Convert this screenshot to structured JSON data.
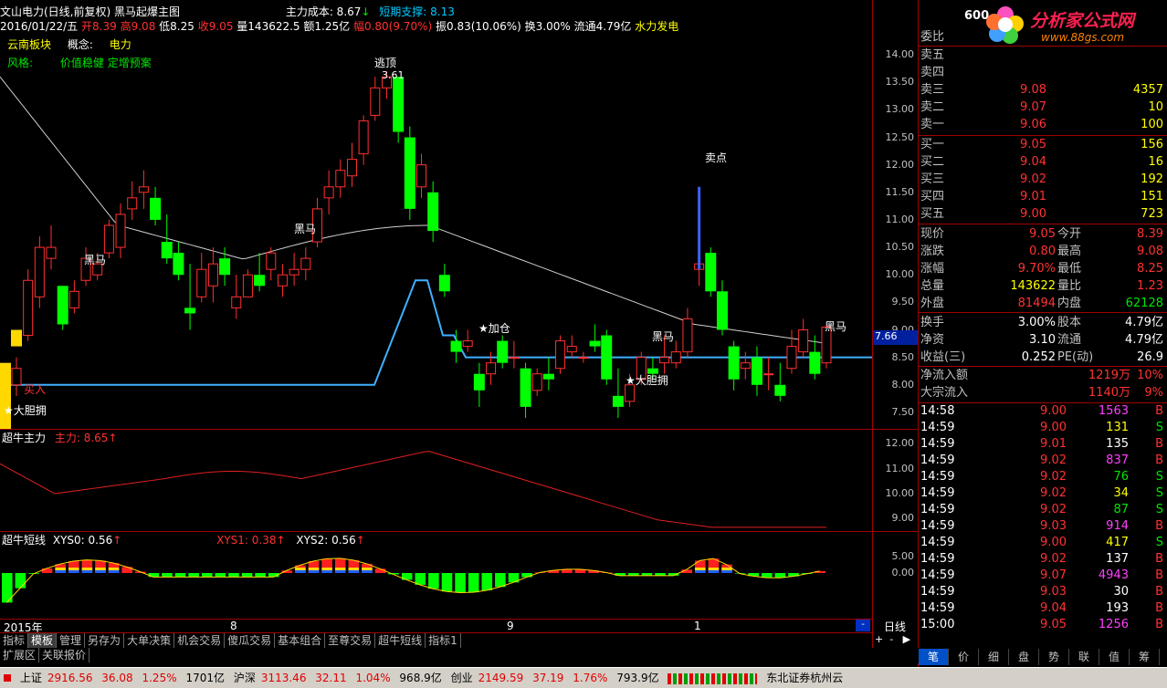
{
  "header": {
    "title": "文山电力(日线,前复权) 黑马起爆主图",
    "cost_label": "主力成本: 8.67",
    "cost_arrow": "↓",
    "support_label": "短期支撑: 8.13",
    "date": "2016/01/22/五",
    "open": "开8.39",
    "high": "高9.08",
    "low": "低8.25",
    "close": "收9.05",
    "vol": "量143622.5",
    "amount": "额1.25亿",
    "change": "幅0.80(9.70%)",
    "amplitude": "振0.83(10.06%)",
    "turnover": "换3.00%",
    "float": "流通4.79亿",
    "industry": "水力发电"
  },
  "tags": {
    "sector": "云南板块",
    "concept_label": "概念:",
    "concept": "电力",
    "style_label": "风格:",
    "style": "价值稳健 定增预案"
  },
  "annotations": {
    "escape": "逃顶",
    "escape_price": "3.61",
    "sell": "卖点",
    "heima": "黑马",
    "bold": "★大胆拥",
    "add": "★加仓",
    "buy": "买入"
  },
  "price_axis": [
    "14.00",
    "13.50",
    "13.00",
    "12.50",
    "12.00",
    "11.50",
    "11.00",
    "10.50",
    "10.00",
    "9.50",
    "9.00",
    "8.50",
    "8.00",
    "7.50"
  ],
  "cursor_price": "7.66",
  "indicator1": {
    "name": "超牛主力",
    "value": "主力: 8.65",
    "arrow": "↑",
    "axis": [
      "12.00",
      "11.00",
      "10.00",
      "9.00"
    ]
  },
  "indicator2": {
    "name": "超牛短线",
    "xys0": "XYS0: 0.56",
    "xys1": "XYS1: 0.38",
    "xys2": "XYS2: 0.56",
    "axis": [
      "5.00",
      "0.00"
    ]
  },
  "time_axis": {
    "year": "2015年",
    "m8": "8",
    "m9": "9",
    "m1": "1",
    "period": "日线"
  },
  "chart_data": {
    "type": "candlestick",
    "ylim": [
      7.2,
      14.4
    ],
    "candles": [
      [
        8.0,
        8.5,
        7.8,
        8.3
      ],
      [
        8.9,
        10.1,
        8.8,
        9.9
      ],
      [
        9.6,
        10.7,
        9.4,
        10.5
      ],
      [
        10.3,
        10.9,
        10.1,
        10.5
      ],
      [
        9.8,
        9.8,
        9.0,
        9.1
      ],
      [
        9.4,
        9.9,
        9.3,
        9.7
      ],
      [
        9.9,
        10.5,
        9.8,
        10.3
      ],
      [
        10.0,
        10.4,
        9.9,
        10.2
      ],
      [
        10.4,
        11.0,
        10.3,
        10.9
      ],
      [
        10.5,
        11.3,
        10.3,
        11.1
      ],
      [
        11.2,
        11.7,
        11.0,
        11.4
      ],
      [
        11.5,
        11.9,
        11.2,
        11.6
      ],
      [
        11.4,
        11.6,
        10.9,
        11.0
      ],
      [
        10.6,
        11.1,
        10.2,
        10.3
      ],
      [
        10.4,
        10.6,
        9.9,
        10.0
      ],
      [
        9.4,
        10.2,
        9.0,
        9.3
      ],
      [
        9.6,
        10.4,
        9.5,
        10.1
      ],
      [
        9.8,
        10.5,
        9.5,
        10.2
      ],
      [
        10.3,
        10.5,
        9.8,
        10.0
      ],
      [
        9.4,
        10.0,
        9.2,
        9.6
      ],
      [
        9.6,
        10.1,
        9.6,
        10.0
      ],
      [
        10.0,
        10.4,
        9.7,
        9.8
      ],
      [
        10.1,
        10.5,
        9.9,
        10.4
      ],
      [
        9.8,
        10.2,
        9.6,
        10.0
      ],
      [
        10.0,
        10.4,
        9.8,
        10.1
      ],
      [
        10.1,
        10.5,
        9.9,
        10.3
      ],
      [
        10.6,
        11.4,
        10.5,
        11.2
      ],
      [
        11.4,
        11.9,
        11.1,
        11.6
      ],
      [
        11.6,
        12.1,
        11.4,
        11.9
      ],
      [
        11.8,
        12.4,
        11.6,
        12.1
      ],
      [
        12.2,
        12.9,
        12.0,
        12.8
      ],
      [
        12.9,
        13.6,
        12.8,
        13.4
      ],
      [
        13.4,
        13.7,
        13.2,
        13.6
      ],
      [
        13.6,
        13.6,
        12.4,
        12.6
      ],
      [
        12.5,
        12.7,
        11.0,
        11.2
      ],
      [
        11.6,
        12.2,
        11.4,
        12.0
      ],
      [
        11.5,
        11.7,
        10.6,
        10.8
      ],
      [
        10.0,
        10.2,
        9.6,
        9.7
      ],
      [
        8.8,
        9.0,
        8.4,
        8.6
      ],
      [
        8.7,
        9.0,
        8.6,
        8.8
      ],
      [
        8.2,
        8.4,
        7.6,
        7.9
      ],
      [
        8.2,
        8.6,
        8.0,
        8.4
      ],
      [
        8.8,
        8.9,
        8.3,
        8.4
      ],
      [
        8.5,
        8.8,
        8.3,
        8.5
      ],
      [
        8.3,
        8.4,
        7.4,
        7.6
      ],
      [
        7.9,
        8.3,
        7.8,
        8.2
      ],
      [
        8.2,
        8.5,
        7.9,
        8.1
      ],
      [
        8.3,
        8.9,
        8.2,
        8.8
      ],
      [
        8.6,
        8.9,
        8.5,
        8.7
      ],
      [
        8.5,
        8.6,
        8.4,
        8.5
      ],
      [
        8.8,
        9.1,
        8.6,
        8.7
      ],
      [
        8.9,
        9.0,
        8.0,
        8.1
      ],
      [
        7.8,
        8.3,
        7.4,
        7.6
      ],
      [
        7.7,
        8.2,
        7.6,
        8.0
      ],
      [
        8.1,
        8.6,
        8.0,
        8.5
      ],
      [
        8.3,
        8.5,
        8.1,
        8.2
      ],
      [
        8.4,
        8.9,
        8.2,
        8.5
      ],
      [
        8.4,
        8.8,
        8.3,
        8.6
      ],
      [
        8.6,
        9.4,
        8.5,
        9.2
      ],
      [
        10.1,
        11.2,
        9.8,
        10.2
      ],
      [
        10.4,
        10.5,
        9.6,
        9.7
      ],
      [
        9.7,
        9.9,
        8.9,
        9.0
      ],
      [
        8.7,
        8.8,
        7.9,
        8.1
      ],
      [
        8.3,
        8.6,
        8.1,
        8.4
      ],
      [
        8.5,
        8.7,
        7.8,
        8.0
      ],
      [
        8.2,
        8.5,
        7.9,
        8.2
      ],
      [
        8.0,
        8.4,
        7.7,
        7.8
      ],
      [
        8.3,
        9.0,
        8.2,
        8.7
      ],
      [
        8.6,
        9.2,
        8.5,
        9.0
      ],
      [
        8.6,
        8.9,
        8.1,
        8.2
      ],
      [
        8.4,
        9.1,
        8.3,
        9.05
      ]
    ]
  },
  "quote": {
    "code": "600",
    "wb_label": "委比",
    "sell": [
      {
        "l": "卖五",
        "p": "",
        "v": ""
      },
      {
        "l": "卖四",
        "p": "",
        "v": ""
      },
      {
        "l": "卖三",
        "p": "9.08",
        "v": "4357"
      },
      {
        "l": "卖二",
        "p": "9.07",
        "v": "10"
      },
      {
        "l": "卖一",
        "p": "9.06",
        "v": "100"
      }
    ],
    "buy": [
      {
        "l": "买一",
        "p": "9.05",
        "v": "156"
      },
      {
        "l": "买二",
        "p": "9.04",
        "v": "16"
      },
      {
        "l": "买三",
        "p": "9.02",
        "v": "192"
      },
      {
        "l": "买四",
        "p": "9.01",
        "v": "151"
      },
      {
        "l": "买五",
        "p": "9.00",
        "v": "723"
      }
    ],
    "stats": [
      {
        "a": "现价",
        "av": "9.05",
        "b": "今开",
        "bv": "8.39"
      },
      {
        "a": "涨跌",
        "av": "0.80",
        "b": "最高",
        "bv": "9.08"
      },
      {
        "a": "涨幅",
        "av": "9.70%",
        "b": "最低",
        "bv": "8.25"
      },
      {
        "a": "总量",
        "av": "143622",
        "b": "量比",
        "bv": "1.23"
      },
      {
        "a": "外盘",
        "av": "81494",
        "b": "内盘",
        "bv": "62128"
      }
    ],
    "stats2": [
      {
        "a": "换手",
        "av": "3.00%",
        "b": "股本",
        "bv": "4.79亿"
      },
      {
        "a": "净资",
        "av": "3.10",
        "b": "流通",
        "bv": "4.79亿"
      },
      {
        "a": "收益(三)",
        "av": "0.252",
        "b": "PE(动)",
        "bv": "26.9"
      }
    ],
    "flow": [
      {
        "a": "净流入额",
        "v": "1219万",
        "p": "10%"
      },
      {
        "a": "大宗流入",
        "v": "1140万",
        "p": "9%"
      }
    ],
    "ticks": [
      [
        "14:58",
        "9.00",
        "1563",
        "B",
        "mag"
      ],
      [
        "14:59",
        "9.00",
        "131",
        "S",
        "yel"
      ],
      [
        "14:59",
        "9.01",
        "135",
        "B",
        "wht"
      ],
      [
        "14:59",
        "9.02",
        "837",
        "B",
        "mag"
      ],
      [
        "14:59",
        "9.02",
        "76",
        "S",
        "grn"
      ],
      [
        "14:59",
        "9.02",
        "34",
        "S",
        "yel"
      ],
      [
        "14:59",
        "9.02",
        "87",
        "S",
        "grn"
      ],
      [
        "14:59",
        "9.03",
        "914",
        "B",
        "mag"
      ],
      [
        "14:59",
        "9.00",
        "417",
        "S",
        "yel"
      ],
      [
        "14:59",
        "9.02",
        "137",
        "B",
        "wht"
      ],
      [
        "14:59",
        "9.07",
        "4943",
        "B",
        "mag"
      ],
      [
        "14:59",
        "9.03",
        "30",
        "B",
        "wht"
      ],
      [
        "14:59",
        "9.04",
        "193",
        "B",
        "wht"
      ],
      [
        "15:00",
        "9.05",
        "1256",
        "B",
        "mag"
      ]
    ]
  },
  "tabs": [
    "指标",
    "模板",
    "管理",
    "另存为",
    "大单决策",
    "机会交易",
    "傻瓜交易",
    "基本组合",
    "至尊交易",
    "超牛短线",
    "指标1"
  ],
  "tabs2": [
    "扩展区",
    "关联报价"
  ],
  "rtabs": [
    "笔",
    "价",
    "细",
    "盘",
    "势",
    "联",
    "值",
    "筹"
  ],
  "rtabs_active": "笔",
  "status": {
    "sh": "上证",
    "sh_v": "2916.56",
    "sh_c": "36.08",
    "sh_p": "1.25%",
    "sh_a": "1701亿",
    "hs": "沪深",
    "hs_v": "3113.46",
    "hs_c": "32.11",
    "hs_p": "1.04%",
    "hs_a": "968.9亿",
    "cy": "创业",
    "cy_v": "2149.59",
    "cy_c": "37.19",
    "cy_p": "1.76%",
    "cy_a": "793.9亿",
    "broker": "东北证券杭州云"
  },
  "logo": {
    "text": "分析家公式网",
    "url": "www.88gs.com"
  }
}
